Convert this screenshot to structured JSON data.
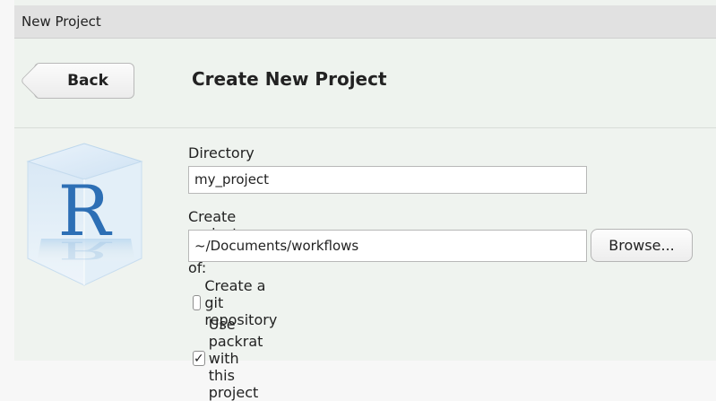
{
  "window": {
    "title": "New Project"
  },
  "header": {
    "back_label": "Back",
    "title": "Create New Project"
  },
  "logo": {
    "letter": "R"
  },
  "form": {
    "directory_label": "Directory name:",
    "directory_value": "my_project",
    "parent_label": "Create project as subdirectory of:",
    "parent_value": "~/Documents/workflows",
    "browse_label": "Browse...",
    "git_label": "Create a git repository",
    "git_checked": false,
    "packrat_label": "Use packrat with this project",
    "packrat_checked": true,
    "check_glyph": "✓"
  },
  "colors": {
    "background": "#eff3ef",
    "titlebar": "#e1e1e1",
    "logo_blue": "#2d6fb5"
  }
}
